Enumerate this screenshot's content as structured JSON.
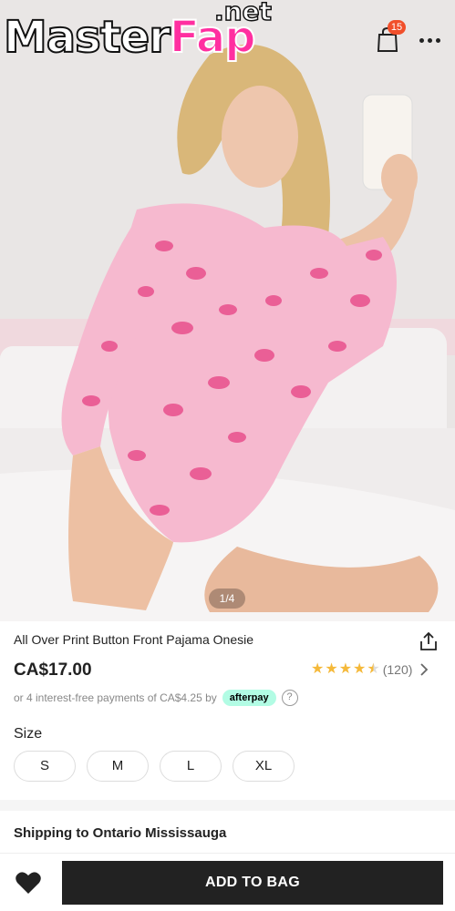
{
  "watermark": {
    "main": "Master",
    "accent": "Fap",
    "suffix": ".net"
  },
  "header": {
    "cart_count": "15"
  },
  "gallery": {
    "pager": "1/4"
  },
  "product": {
    "title": "All Over Print Button Front Pajama Onesie",
    "price": "CA$17.00",
    "rating": {
      "stars": 4.5,
      "max": 5,
      "reviews": "(120)"
    },
    "installment_text": "or 4 interest-free payments of CA$4.25 by",
    "afterpay_label": "afterpay",
    "help_label": "?"
  },
  "size": {
    "label": "Size",
    "options": [
      "S",
      "M",
      "L",
      "XL"
    ]
  },
  "shipping": {
    "label": "Shipping to Ontario Mississauga"
  },
  "actions": {
    "add_to_bag": "ADD TO BAG"
  },
  "colors": {
    "accent_pink": "#ff2fa0",
    "badge": "#f14f2a",
    "star": "#f5b93a",
    "afterpay": "#b2fce4",
    "cta": "#222222"
  },
  "icons": [
    "bag-icon",
    "more-icon",
    "share-icon",
    "chevron-right-icon",
    "help-icon",
    "heart-icon"
  ]
}
